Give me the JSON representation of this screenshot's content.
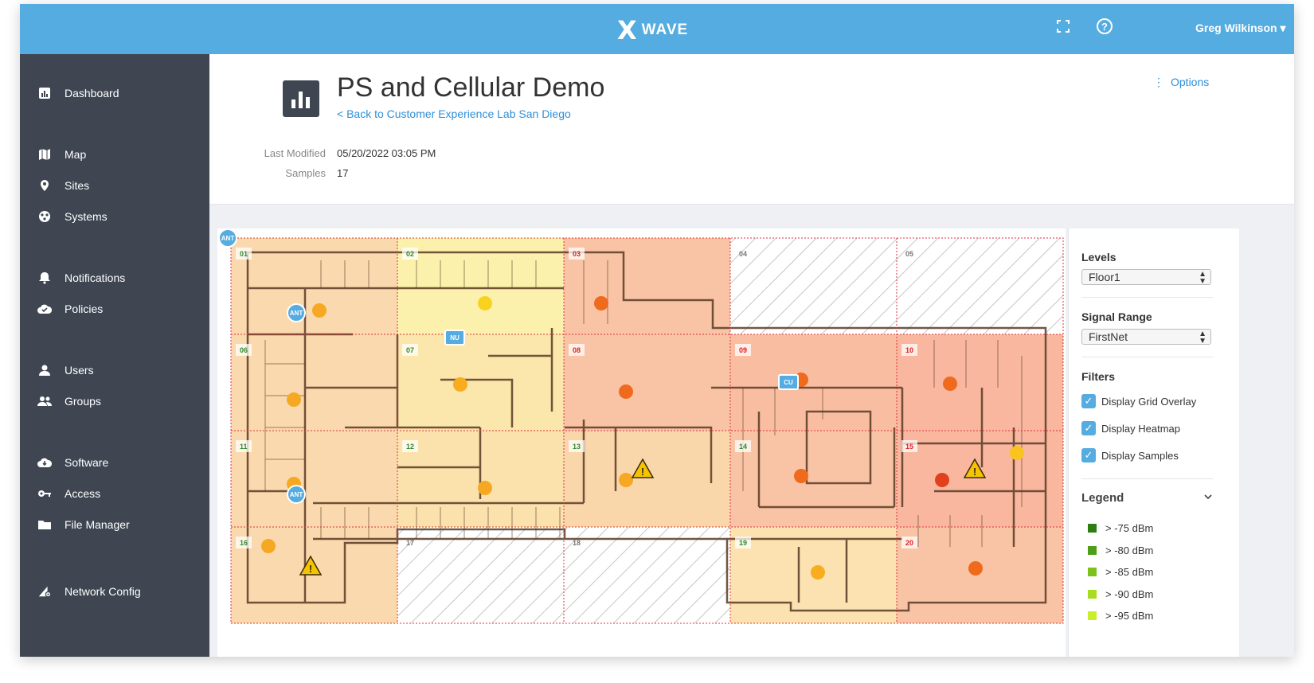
{
  "app": {
    "brand_mark": "X",
    "brand_name": "WAVE",
    "user_name": "Greg Wilkinson ▾"
  },
  "sidebar": {
    "items": [
      {
        "label": "Dashboard",
        "icon": "dashboard-icon"
      },
      {
        "label": "Map",
        "icon": "map-icon"
      },
      {
        "label": "Sites",
        "icon": "location-pin-icon"
      },
      {
        "label": "Systems",
        "icon": "systems-icon"
      },
      {
        "label": "Notifications",
        "icon": "bell-icon"
      },
      {
        "label": "Policies",
        "icon": "cloud-check-icon"
      },
      {
        "label": "Users",
        "icon": "user-icon"
      },
      {
        "label": "Groups",
        "icon": "group-icon"
      },
      {
        "label": "Software",
        "icon": "cloud-download-icon"
      },
      {
        "label": "Access",
        "icon": "key-icon"
      },
      {
        "label": "File Manager",
        "icon": "folder-icon"
      },
      {
        "label": "Network Config",
        "icon": "network-config-icon"
      }
    ]
  },
  "header": {
    "title": "PS and Cellular Demo",
    "back_link": "< Back to Customer Experience Lab San Diego",
    "last_modified_label": "Last Modified",
    "last_modified_value": "05/20/2022 03:05 PM",
    "samples_label": "Samples",
    "samples_value": "17",
    "options_label": "Options"
  },
  "map": {
    "grid_cells": [
      "01",
      "02",
      "03",
      "04",
      "05",
      "06",
      "07",
      "08",
      "09",
      "10",
      "11",
      "12",
      "13",
      "14",
      "15",
      "16",
      "17",
      "18",
      "19",
      "20"
    ],
    "markers": [
      "ANT",
      "ANT",
      "ANT",
      "NU",
      "CU"
    ]
  },
  "panel": {
    "levels_label": "Levels",
    "levels_value": "Floor1",
    "signal_label": "Signal Range",
    "signal_value": "FirstNet",
    "filters_label": "Filters",
    "filters": [
      {
        "label": "Display Grid Overlay",
        "checked": true
      },
      {
        "label": "Display Heatmap",
        "checked": true
      },
      {
        "label": "Display Samples",
        "checked": true
      }
    ],
    "legend_label": "Legend",
    "legend": [
      {
        "label": "> -75 dBm",
        "color": "#2e7d12"
      },
      {
        "label": "> -80 dBm",
        "color": "#4f9e18"
      },
      {
        "label": "> -85 dBm",
        "color": "#7cc21c"
      },
      {
        "label": "> -90 dBm",
        "color": "#a6dd1f"
      },
      {
        "label": "> -95 dBm",
        "color": "#c8ee2c"
      }
    ]
  },
  "colors": {
    "topbar": "#55ace0",
    "sidebar": "#3f4652",
    "link": "#2f8fd8"
  }
}
